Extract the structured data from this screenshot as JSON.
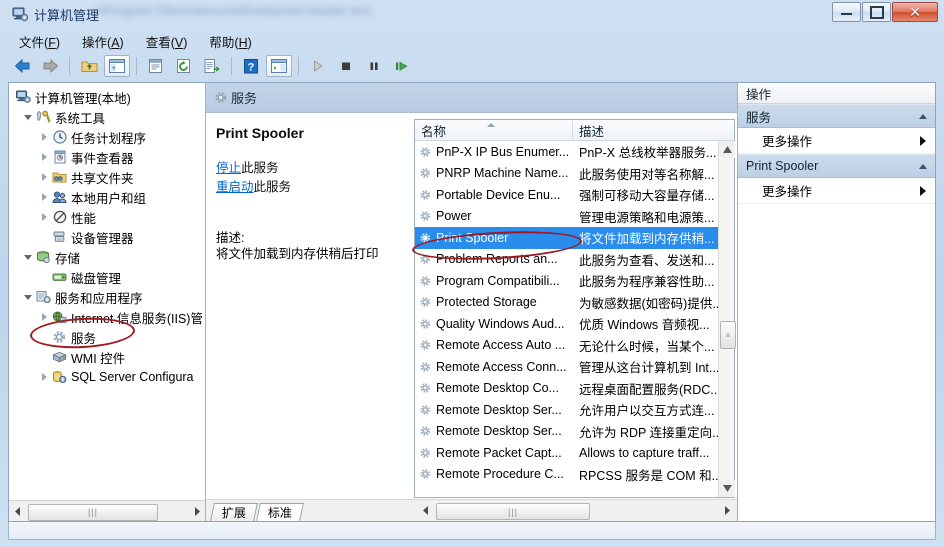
{
  "window": {
    "title": "计算机管理",
    "title_blurred_suffix": "\\\\Program Files\\\\obscured\\\\redacted header text",
    "icon": "computer-management-icon",
    "buttons": {
      "minimize": "最小化",
      "maximize": "最大化",
      "close": "✕"
    }
  },
  "menubar": [
    {
      "label": "文件",
      "accel": "F"
    },
    {
      "label": "操作",
      "accel": "A"
    },
    {
      "label": "查看",
      "accel": "V"
    },
    {
      "label": "帮助",
      "accel": "H"
    }
  ],
  "toolbar": [
    {
      "name": "back-icon",
      "title": "后退"
    },
    {
      "name": "forward-icon",
      "title": "前进"
    },
    {
      "name": "up-folder-icon",
      "title": "向上一级"
    },
    {
      "name": "show-tree-icon",
      "title": "显示/隐藏控制台树"
    },
    {
      "name": "properties-icon",
      "title": "属性"
    },
    {
      "name": "refresh-icon",
      "title": "刷新"
    },
    {
      "name": "export-list-icon",
      "title": "导出列表"
    },
    {
      "name": "help-icon",
      "title": "帮助"
    },
    {
      "name": "show-details-icon",
      "title": "显示/隐藏操作窗格"
    },
    {
      "name": "start-service-icon",
      "title": "启动服务"
    },
    {
      "name": "stop-service-icon",
      "title": "停止服务"
    },
    {
      "name": "pause-service-icon",
      "title": "暂停服务"
    },
    {
      "name": "restart-service-icon",
      "title": "重新启动服务"
    }
  ],
  "tree": {
    "root": {
      "label": "计算机管理(本地)",
      "icon": "computer-icon"
    },
    "items": [
      {
        "label": "系统工具",
        "icon": "tools-icon",
        "depth": 1,
        "expander": "open"
      },
      {
        "label": "任务计划程序",
        "icon": "clock-icon",
        "depth": 2,
        "expander": "closed"
      },
      {
        "label": "事件查看器",
        "icon": "event-log-icon",
        "depth": 2,
        "expander": "closed"
      },
      {
        "label": "共享文件夹",
        "icon": "shared-folder-icon",
        "depth": 2,
        "expander": "closed"
      },
      {
        "label": "本地用户和组",
        "icon": "users-icon",
        "depth": 2,
        "expander": "closed"
      },
      {
        "label": "性能",
        "icon": "performance-icon",
        "depth": 2,
        "expander": "closed"
      },
      {
        "label": "设备管理器",
        "icon": "device-manager-icon",
        "depth": 2,
        "expander": "none"
      },
      {
        "label": "存储",
        "icon": "storage-icon",
        "depth": 1,
        "expander": "open"
      },
      {
        "label": "磁盘管理",
        "icon": "disk-icon",
        "depth": 2,
        "expander": "none"
      },
      {
        "label": "服务和应用程序",
        "icon": "services-apps-icon",
        "depth": 1,
        "expander": "open"
      },
      {
        "label": "Internet 信息服务(IIS)管",
        "icon": "iis-icon",
        "depth": 2,
        "expander": "closed"
      },
      {
        "label": "服务",
        "icon": "service-gear-icon",
        "depth": 2,
        "expander": "none"
      },
      {
        "label": "WMI 控件",
        "icon": "wmi-icon",
        "depth": 2,
        "expander": "none"
      },
      {
        "label": "SQL Server Configura",
        "icon": "sql-server-icon",
        "depth": 2,
        "expander": "closed"
      }
    ],
    "hscroll_grip": "|||"
  },
  "middle": {
    "header": {
      "label": "服务",
      "icon": "service-gear-icon"
    },
    "detail": {
      "title": "Print Spooler",
      "stop_link": "停止",
      "stop_suffix": "此服务",
      "restart_link": "重启动",
      "restart_suffix": "此服务",
      "desc_label": "描述:",
      "desc_text": "将文件加载到内存供稍后打印"
    },
    "columns": [
      "名称",
      "描述"
    ],
    "rows": [
      {
        "name": "PnP-X IP Bus Enumer...",
        "desc": "PnP-X 总线枚举器服务...",
        "selected": false
      },
      {
        "name": "PNRP Machine Name...",
        "desc": "此服务使用对等名称解...",
        "selected": false
      },
      {
        "name": "Portable Device Enu...",
        "desc": "强制可移动大容量存储...",
        "selected": false
      },
      {
        "name": "Power",
        "desc": "管理电源策略和电源策...",
        "selected": false
      },
      {
        "name": "Print Spooler",
        "desc": "将文件加载到内存供稍...",
        "selected": true
      },
      {
        "name": "Problem Reports an...",
        "desc": "此服务为查看、发送和...",
        "selected": false
      },
      {
        "name": "Program Compatibili...",
        "desc": "此服务为程序兼容性助...",
        "selected": false
      },
      {
        "name": "Protected Storage",
        "desc": "为敏感数据(如密码)提供...",
        "selected": false
      },
      {
        "name": "Quality Windows Aud...",
        "desc": "优质 Windows 音频视...",
        "selected": false
      },
      {
        "name": "Remote Access Auto ...",
        "desc": "无论什么时候，当某个...",
        "selected": false
      },
      {
        "name": "Remote Access Conn...",
        "desc": "管理从这台计算机到 Int...",
        "selected": false
      },
      {
        "name": "Remote Desktop Co...",
        "desc": "远程桌面配置服务(RDC...",
        "selected": false
      },
      {
        "name": "Remote Desktop Ser...",
        "desc": "允许用户以交互方式连...",
        "selected": false
      },
      {
        "name": "Remote Desktop Ser...",
        "desc": "允许为 RDP 连接重定向...",
        "selected": false
      },
      {
        "name": "Remote Packet Capt...",
        "desc": "Allows to capture traff...",
        "selected": false
      },
      {
        "name": "Remote Procedure C...",
        "desc": "RPCSS 服务是 COM 和...",
        "selected": false
      }
    ],
    "tabs": [
      {
        "label": "扩展",
        "active": false
      },
      {
        "label": "标准",
        "active": true
      }
    ],
    "hscroll_grip": "|||"
  },
  "actions": {
    "header": "操作",
    "groups": [
      {
        "title": "服务",
        "items": [
          "更多操作"
        ]
      },
      {
        "title": "Print Spooler",
        "items": [
          "更多操作"
        ]
      }
    ]
  },
  "colors": {
    "selection": "#2a8ceb",
    "link": "#0066cc",
    "annotation": "#9c1c22",
    "header_blue": "#c0d2e6"
  },
  "annotations": [
    {
      "name": "tree-services-highlight",
      "shape": "ellipse"
    },
    {
      "name": "print-spooler-row-highlight",
      "shape": "ellipse"
    }
  ]
}
